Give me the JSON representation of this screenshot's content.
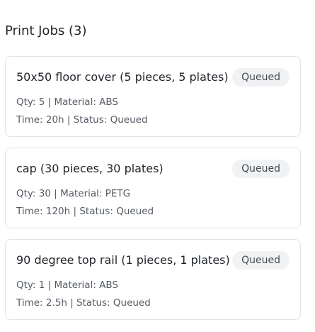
{
  "header": {
    "title": "Print Jobs (3)"
  },
  "jobs": [
    {
      "title": "50x50 floor cover (5 pieces, 5 plates)",
      "status_badge": "Queued",
      "meta_line_1": "Qty: 5 | Material: ABS",
      "meta_line_2": "Time: 20h | Status: Queued"
    },
    {
      "title": "cap (30 pieces, 30 plates)",
      "status_badge": "Queued",
      "meta_line_1": "Qty: 30 | Material: PETG",
      "meta_line_2": "Time: 120h | Status: Queued"
    },
    {
      "title": "90 degree top rail (1 pieces, 1 plates)",
      "status_badge": "Queued",
      "meta_line_1": "Qty: 1 | Material: ABS",
      "meta_line_2": "Time: 2.5h | Status: Queued"
    }
  ],
  "colors": {
    "text": "#1f2328",
    "muted_text": "#555b63",
    "card_border": "#e1e4e8",
    "badge_bg": "#f1f2f4",
    "badge_text": "#444a52"
  }
}
